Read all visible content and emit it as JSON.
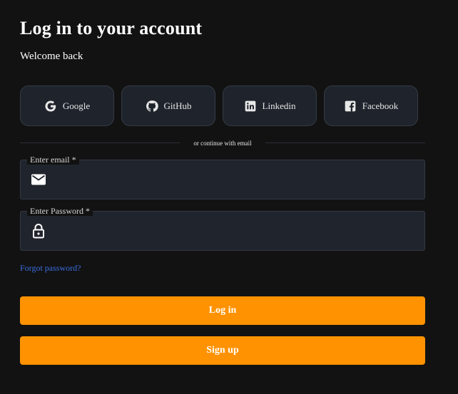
{
  "header": {
    "title": "Log in to your account",
    "subtitle": "Welcome back"
  },
  "social": [
    {
      "label": "Google",
      "icon": "google-icon"
    },
    {
      "label": "GitHub",
      "icon": "github-icon"
    },
    {
      "label": "Linkedin",
      "icon": "linkedin-icon"
    },
    {
      "label": "Facebook",
      "icon": "facebook-icon"
    }
  ],
  "divider": {
    "text": "or continue with email"
  },
  "form": {
    "email": {
      "label": "Enter email *",
      "value": "",
      "placeholder": "",
      "icon": "mail-icon"
    },
    "password": {
      "label": "Enter Password *",
      "value": "",
      "placeholder": "",
      "icon": "lock-icon"
    },
    "forgot_label": "Forgot password?"
  },
  "actions": {
    "login_label": "Log in",
    "signup_label": "Sign up"
  },
  "colors": {
    "background": "#121212",
    "surface": "#20242d",
    "accent": "#ff9200",
    "link": "#3b6ee0"
  }
}
